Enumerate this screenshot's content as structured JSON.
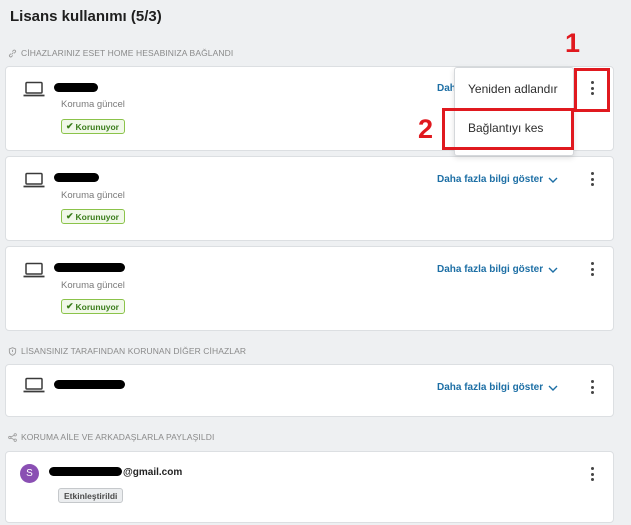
{
  "page": {
    "title": "Lisans kullanımı (5/3)"
  },
  "sections": {
    "connected": "CİHAZLARINIZ ESET HOME HESABINIZA BAĞLANDI",
    "other_devices": "LİSANSINIZ TARAFINDAN KORUNAN DİĞER CİHAZLAR",
    "shared": "KORUMA AİLE VE ARKADAŞLARLA PAYLAŞILDI"
  },
  "devices": [
    {
      "status": "Koruma güncel",
      "badge": "Korunuyor",
      "more": "Daha"
    },
    {
      "status": "Koruma güncel",
      "badge": "Korunuyor",
      "more": "Daha fazla bilgi göster"
    },
    {
      "status": "Koruma güncel",
      "badge": "Korunuyor",
      "more": "Daha fazla bilgi göster"
    }
  ],
  "other_device": {
    "more": "Daha fazla bilgi göster"
  },
  "shared_user": {
    "avatar_letter": "S",
    "email_suffix": "@gmail.com",
    "badge": "Etkinleştirildi"
  },
  "menu": {
    "items": [
      "Yeniden adlandır",
      "Bağlantıyı kes"
    ]
  },
  "annotations": {
    "one": "1",
    "two": "2"
  },
  "colors": {
    "accent_red": "#e0191f",
    "link_blue": "#1d6fa5",
    "protected_green": "#3b7d1b",
    "avatar_purple": "#8a4fb3"
  },
  "icons": [
    "laptop-icon",
    "link-icon",
    "shield-icon",
    "share-icon",
    "chevron-down-icon",
    "kebab-menu-icon",
    "checkmark-icon"
  ]
}
